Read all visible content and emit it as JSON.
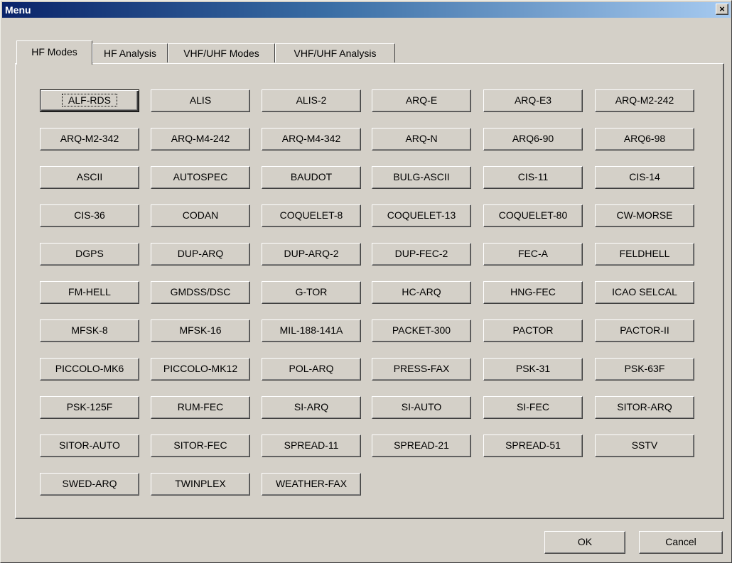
{
  "window": {
    "title": "Menu",
    "close_glyph": "×"
  },
  "tabs": [
    {
      "label": "HF Modes",
      "active": true
    },
    {
      "label": "HF Analysis",
      "active": false
    },
    {
      "label": "VHF/UHF Modes",
      "active": false
    },
    {
      "label": "VHF/UHF Analysis",
      "active": false
    }
  ],
  "modes": [
    "ALF-RDS",
    "ALIS",
    "ALIS-2",
    "ARQ-E",
    "ARQ-E3",
    "ARQ-M2-242",
    "ARQ-M2-342",
    "ARQ-M4-242",
    "ARQ-M4-342",
    "ARQ-N",
    "ARQ6-90",
    "ARQ6-98",
    "ASCII",
    "AUTOSPEC",
    "BAUDOT",
    "BULG-ASCII",
    "CIS-11",
    "CIS-14",
    "CIS-36",
    "CODAN",
    "COQUELET-8",
    "COQUELET-13",
    "COQUELET-80",
    "CW-MORSE",
    "DGPS",
    "DUP-ARQ",
    "DUP-ARQ-2",
    "DUP-FEC-2",
    "FEC-A",
    "FELDHELL",
    "FM-HELL",
    "GMDSS/DSC",
    "G-TOR",
    "HC-ARQ",
    "HNG-FEC",
    "ICAO SELCAL",
    "MFSK-8",
    "MFSK-16",
    "MIL-188-141A",
    "PACKET-300",
    "PACTOR",
    "PACTOR-II",
    "PICCOLO-MK6",
    "PICCOLO-MK12",
    "POL-ARQ",
    "PRESS-FAX",
    "PSK-31",
    "PSK-63F",
    "PSK-125F",
    "RUM-FEC",
    "SI-ARQ",
    "SI-AUTO",
    "SI-FEC",
    "SITOR-ARQ",
    "SITOR-AUTO",
    "SITOR-FEC",
    "SPREAD-11",
    "SPREAD-21",
    "SPREAD-51",
    "SSTV",
    "SWED-ARQ",
    "TWINPLEX",
    "WEATHER-FAX"
  ],
  "focused_mode": "ALF-RDS",
  "footer": {
    "ok_label": "OK",
    "cancel_label": "Cancel"
  }
}
